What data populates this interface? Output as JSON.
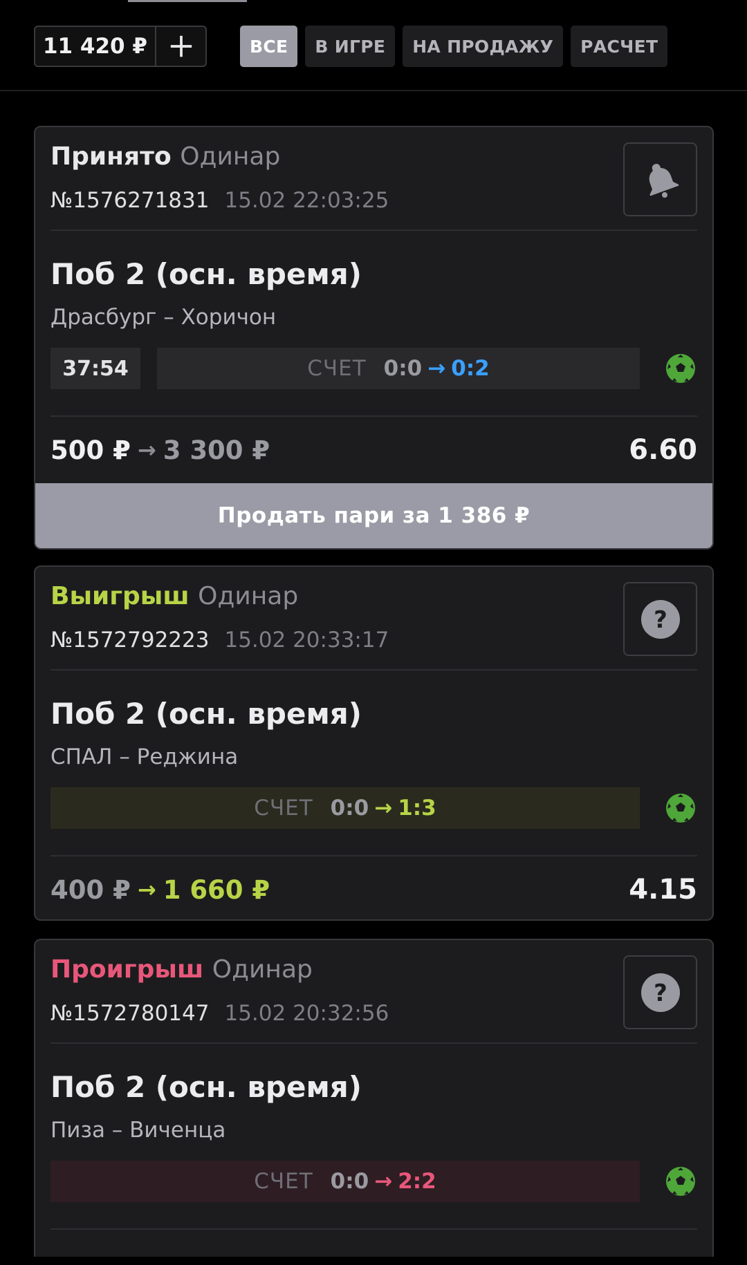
{
  "header": {
    "balance": "11 420 ₽",
    "add_icon": "plus-icon",
    "filters": [
      {
        "label": "ВСЕ",
        "active": true
      },
      {
        "label": "В ИГРЕ",
        "active": false
      },
      {
        "label": "НА ПРОДАЖУ",
        "active": false
      },
      {
        "label": "РАСЧЕТ",
        "active": false
      }
    ]
  },
  "colors": {
    "accepted": "#e8e8ea",
    "win": "#b7d447",
    "loss": "#e8577a",
    "live_score": "#3aa0ff",
    "sell_button": "#9a9ba6",
    "ball": "#4fa73a"
  },
  "bets": [
    {
      "status": "Принято",
      "type": "Одинар",
      "id": "№1576271831",
      "datetime": "15.02 22:03:25",
      "action_icon": "bell-icon",
      "market": "Поб 2 (осн. время)",
      "teams": "Драсбург – Хоричон",
      "timer": "37:54",
      "score_label": "СЧЕТ",
      "score_from": "0:0",
      "score_to": "0:2",
      "stake": "500 ₽",
      "payout": "3 300 ₽",
      "odds": "6.60",
      "sell_label": "Продать пари за 1 386 ₽"
    },
    {
      "status": "Выигрыш",
      "type": "Одинар",
      "id": "№1572792223",
      "datetime": "15.02 20:33:17",
      "action_icon": "question-icon",
      "market": "Поб 2 (осн. время)",
      "teams": "СПАЛ – Реджина",
      "score_label": "СЧЕТ",
      "score_from": "0:0",
      "score_to": "1:3",
      "stake": "400 ₽",
      "payout": "1 660 ₽",
      "odds": "4.15"
    },
    {
      "status": "Проигрыш",
      "type": "Одинар",
      "id": "№1572780147",
      "datetime": "15.02 20:32:56",
      "action_icon": "question-icon",
      "market": "Поб 2 (осн. время)",
      "teams": "Пиза – Виченца",
      "score_label": "СЧЕТ",
      "score_from": "0:0",
      "score_to": "2:2"
    }
  ]
}
